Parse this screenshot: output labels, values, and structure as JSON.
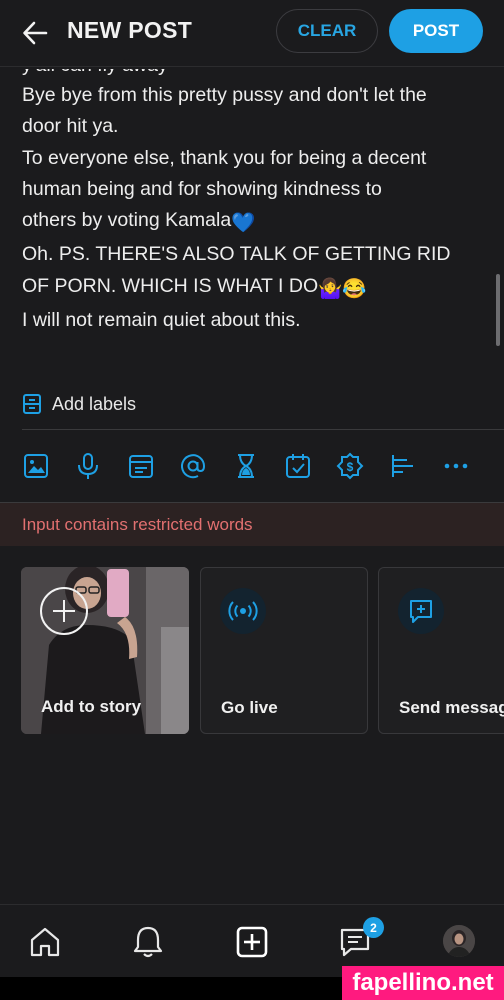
{
  "header": {
    "title": "NEW POST",
    "clear_label": "CLEAR",
    "post_label": "POST"
  },
  "post": {
    "cut_line": "y'all can fly away",
    "lines": [
      "Bye bye from this pretty pussy and don't let the",
      "door hit ya.",
      "To everyone else, thank you for being a decent",
      "human being and for showing kindness to",
      "others by voting Kamala",
      "Oh. PS. THERE'S ALSO TALK OF GETTING RID",
      "OF PORN. WHICH IS WHAT I DO",
      "I will not remain quiet about this."
    ],
    "emojis": {
      "heart": "💙",
      "shrug": "🤷‍♀️",
      "laugh": "😂"
    }
  },
  "labels": {
    "label": "Add labels"
  },
  "toolbar": {
    "icons": [
      "image-icon",
      "microphone-icon",
      "gif-icon",
      "mention-icon",
      "hourglass-icon",
      "calendar-check-icon",
      "tip-dollar-icon",
      "poll-icon",
      "more-icon"
    ]
  },
  "warning": {
    "text": "Input contains restricted words"
  },
  "cards": [
    {
      "label": "Add to story"
    },
    {
      "label": "Go live"
    },
    {
      "label": "Send message"
    }
  ],
  "nav": {
    "messages_badge": "2"
  },
  "watermark": {
    "text": "fapellino.net"
  },
  "colors": {
    "accent": "#1ea0e4",
    "warning": "#e27070",
    "background": "#1b1b1d"
  }
}
